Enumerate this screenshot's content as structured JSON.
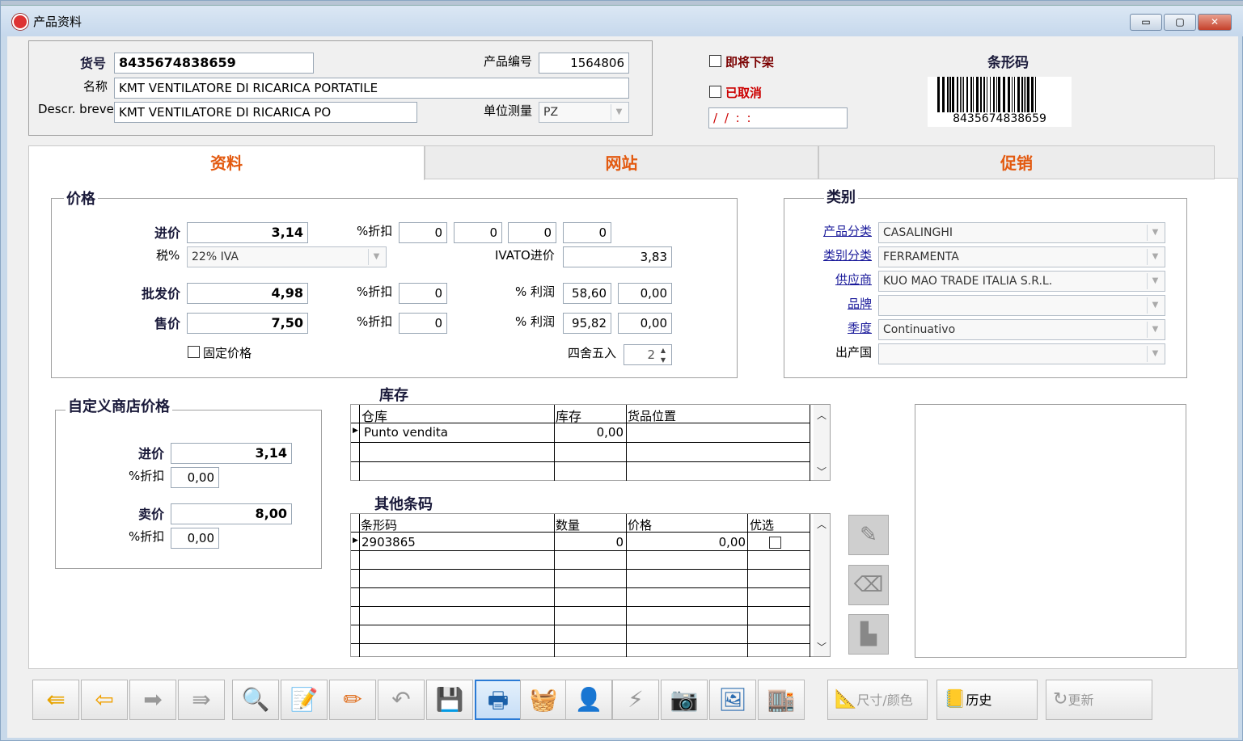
{
  "window": {
    "title": "产品资料",
    "minimize": "▭",
    "maximize": "▢",
    "close": "✕"
  },
  "header": {
    "code_label": "货号",
    "code_value": "8435674838659",
    "product_no_label": "产品编号",
    "product_no_value": "1564806",
    "name_label": "名称",
    "name_value": "KMT VENTILATORE DI RICARICA PORTATILE",
    "descr_label": "Descr. breve",
    "descr_value": "KMT VENTILATORE DI RICARICA PO",
    "unit_label": "单位测量",
    "unit_value": "PZ",
    "soon_off_label": "即将下架",
    "cancelled_label": "已取消",
    "date_value": "/ /     : :",
    "barcode_title": "条形码",
    "barcode_number": "8435674838659"
  },
  "tabs": [
    {
      "label": "资料"
    },
    {
      "label": "网站"
    },
    {
      "label": "促销"
    }
  ],
  "price": {
    "legend": "价格",
    "purchase_label": "进价",
    "purchase_value": "3,14",
    "discount_label": "%折扣",
    "discounts": [
      "0",
      "0",
      "0",
      "0"
    ],
    "tax_label": "税%",
    "tax_value": "22% IVA",
    "ivato_label": "IVATO进价",
    "ivato_value": "3,83",
    "wholesale_label": "批发价",
    "wholesale_value": "4,98",
    "wholesale_discount": "0",
    "profit_label": "% 利润",
    "wholesale_profit": "58,60",
    "wholesale_profit2": "0,00",
    "sale_label": "售价",
    "sale_value": "7,50",
    "sale_discount": "0",
    "sale_profit": "95,82",
    "sale_profit2": "0,00",
    "fixed_label": "固定价格",
    "round_label": "四舍五入",
    "round_value": "2"
  },
  "category": {
    "legend": "类别",
    "rows": [
      {
        "label": "产品分类",
        "value": "CASALINGHI",
        "link": true
      },
      {
        "label": "类别分类",
        "value": "FERRAMENTA",
        "link": true
      },
      {
        "label": "供应商",
        "value": "KUO MAO TRADE ITALIA S.R.L.",
        "link": true
      },
      {
        "label": "品牌",
        "value": "",
        "link": true
      },
      {
        "label": "季度",
        "value": "Continuativo",
        "link": true
      },
      {
        "label": "出产国",
        "value": "",
        "link": false
      }
    ]
  },
  "shop_price": {
    "legend": "自定义商店价格",
    "purchase_label": "进价",
    "purchase_value": "3,14",
    "discount_label": "%折扣",
    "discount1": "0,00",
    "sale_label": "卖价",
    "sale_value": "8,00",
    "discount2": "0,00"
  },
  "stock": {
    "title": "库存",
    "headers": [
      "仓库",
      "库存",
      "货品位置"
    ],
    "rows": [
      {
        "warehouse": "Punto vendita",
        "qty": "0,00",
        "location": ""
      }
    ]
  },
  "other_barcodes": {
    "title": "其他条码",
    "headers": [
      "条形码",
      "数量",
      "价格",
      "优选"
    ],
    "rows": [
      {
        "code": "2903865",
        "qty": "0",
        "price": "0,00"
      }
    ]
  },
  "toolbar": {
    "size_color": "尺寸/颜色",
    "history": "历史",
    "update": "更新"
  },
  "colors": {
    "accent": "#e35a10",
    "link": "#1b1b9b",
    "red": "#cc0000"
  }
}
